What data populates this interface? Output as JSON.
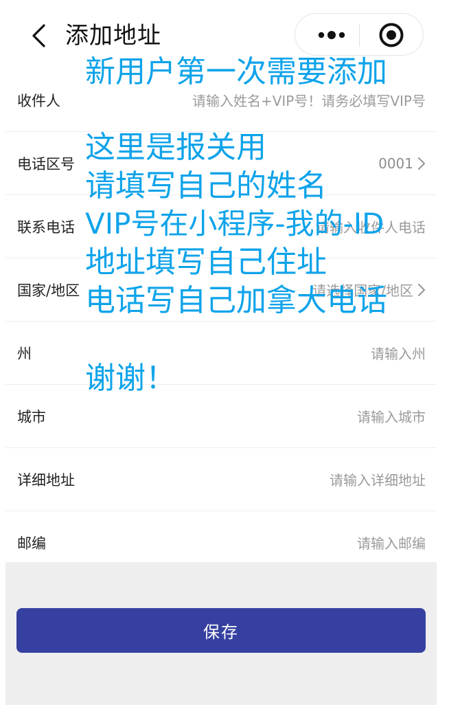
{
  "header": {
    "title": "添加地址",
    "back_icon": "chevron-left-icon",
    "more_icon": "more-dots-icon",
    "close_icon": "target-circle-icon"
  },
  "form": {
    "rows": [
      {
        "label": "收件人",
        "placeholder": "请输入姓名+VIP号！请务必填写VIP号",
        "has_chevron": false
      },
      {
        "label": "电话区号",
        "value": "0001",
        "has_chevron": true
      },
      {
        "label": "联系电话",
        "placeholder": "请输入收件人电话",
        "has_chevron": false
      },
      {
        "label": "国家/地区",
        "placeholder": "请选择国家/地区",
        "has_chevron": true
      },
      {
        "label": "州",
        "placeholder": "请输入州",
        "has_chevron": false
      },
      {
        "label": "城市",
        "placeholder": "请输入城市",
        "has_chevron": false
      },
      {
        "label": "详细地址",
        "placeholder": "请输入详细地址",
        "has_chevron": false
      },
      {
        "label": "邮编",
        "placeholder": "请输入邮编",
        "has_chevron": false
      }
    ]
  },
  "save_button": {
    "label": "保存"
  },
  "annotation": {
    "color": "#0ea3ea",
    "lines": [
      "新用户第一次需要添加",
      "这里是报关用",
      "请填写自己的姓名",
      "VIP号在小程序-我的-ID",
      "地址填写自己住址",
      "电话写自己加拿大电话",
      "谢谢！"
    ]
  },
  "colors": {
    "primary_button": "#3640a0",
    "placeholder_text": "#9a9a9a",
    "footer_background": "#eeeeee"
  }
}
